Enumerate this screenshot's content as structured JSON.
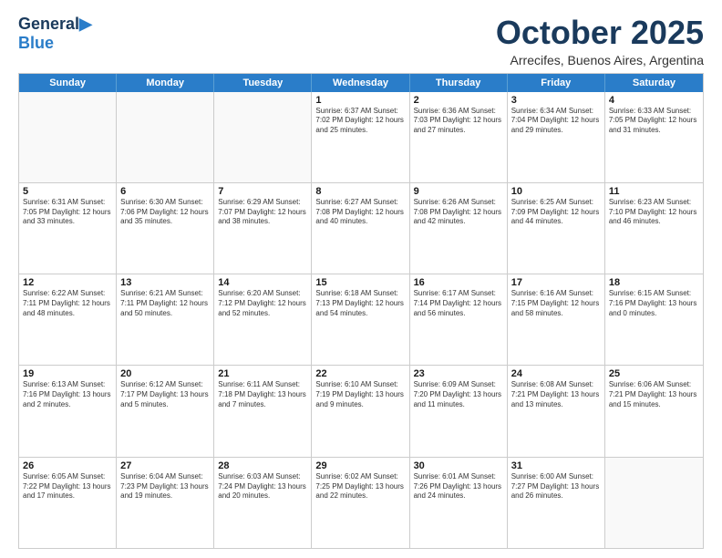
{
  "header": {
    "logo_line1": "General",
    "logo_line2": "Blue",
    "month": "October 2025",
    "location": "Arrecifes, Buenos Aires, Argentina"
  },
  "weekdays": [
    "Sunday",
    "Monday",
    "Tuesday",
    "Wednesday",
    "Thursday",
    "Friday",
    "Saturday"
  ],
  "rows": [
    [
      {
        "day": "",
        "text": ""
      },
      {
        "day": "",
        "text": ""
      },
      {
        "day": "",
        "text": ""
      },
      {
        "day": "1",
        "text": "Sunrise: 6:37 AM\nSunset: 7:02 PM\nDaylight: 12 hours\nand 25 minutes."
      },
      {
        "day": "2",
        "text": "Sunrise: 6:36 AM\nSunset: 7:03 PM\nDaylight: 12 hours\nand 27 minutes."
      },
      {
        "day": "3",
        "text": "Sunrise: 6:34 AM\nSunset: 7:04 PM\nDaylight: 12 hours\nand 29 minutes."
      },
      {
        "day": "4",
        "text": "Sunrise: 6:33 AM\nSunset: 7:05 PM\nDaylight: 12 hours\nand 31 minutes."
      }
    ],
    [
      {
        "day": "5",
        "text": "Sunrise: 6:31 AM\nSunset: 7:05 PM\nDaylight: 12 hours\nand 33 minutes."
      },
      {
        "day": "6",
        "text": "Sunrise: 6:30 AM\nSunset: 7:06 PM\nDaylight: 12 hours\nand 35 minutes."
      },
      {
        "day": "7",
        "text": "Sunrise: 6:29 AM\nSunset: 7:07 PM\nDaylight: 12 hours\nand 38 minutes."
      },
      {
        "day": "8",
        "text": "Sunrise: 6:27 AM\nSunset: 7:08 PM\nDaylight: 12 hours\nand 40 minutes."
      },
      {
        "day": "9",
        "text": "Sunrise: 6:26 AM\nSunset: 7:08 PM\nDaylight: 12 hours\nand 42 minutes."
      },
      {
        "day": "10",
        "text": "Sunrise: 6:25 AM\nSunset: 7:09 PM\nDaylight: 12 hours\nand 44 minutes."
      },
      {
        "day": "11",
        "text": "Sunrise: 6:23 AM\nSunset: 7:10 PM\nDaylight: 12 hours\nand 46 minutes."
      }
    ],
    [
      {
        "day": "12",
        "text": "Sunrise: 6:22 AM\nSunset: 7:11 PM\nDaylight: 12 hours\nand 48 minutes."
      },
      {
        "day": "13",
        "text": "Sunrise: 6:21 AM\nSunset: 7:11 PM\nDaylight: 12 hours\nand 50 minutes."
      },
      {
        "day": "14",
        "text": "Sunrise: 6:20 AM\nSunset: 7:12 PM\nDaylight: 12 hours\nand 52 minutes."
      },
      {
        "day": "15",
        "text": "Sunrise: 6:18 AM\nSunset: 7:13 PM\nDaylight: 12 hours\nand 54 minutes."
      },
      {
        "day": "16",
        "text": "Sunrise: 6:17 AM\nSunset: 7:14 PM\nDaylight: 12 hours\nand 56 minutes."
      },
      {
        "day": "17",
        "text": "Sunrise: 6:16 AM\nSunset: 7:15 PM\nDaylight: 12 hours\nand 58 minutes."
      },
      {
        "day": "18",
        "text": "Sunrise: 6:15 AM\nSunset: 7:16 PM\nDaylight: 13 hours\nand 0 minutes."
      }
    ],
    [
      {
        "day": "19",
        "text": "Sunrise: 6:13 AM\nSunset: 7:16 PM\nDaylight: 13 hours\nand 2 minutes."
      },
      {
        "day": "20",
        "text": "Sunrise: 6:12 AM\nSunset: 7:17 PM\nDaylight: 13 hours\nand 5 minutes."
      },
      {
        "day": "21",
        "text": "Sunrise: 6:11 AM\nSunset: 7:18 PM\nDaylight: 13 hours\nand 7 minutes."
      },
      {
        "day": "22",
        "text": "Sunrise: 6:10 AM\nSunset: 7:19 PM\nDaylight: 13 hours\nand 9 minutes."
      },
      {
        "day": "23",
        "text": "Sunrise: 6:09 AM\nSunset: 7:20 PM\nDaylight: 13 hours\nand 11 minutes."
      },
      {
        "day": "24",
        "text": "Sunrise: 6:08 AM\nSunset: 7:21 PM\nDaylight: 13 hours\nand 13 minutes."
      },
      {
        "day": "25",
        "text": "Sunrise: 6:06 AM\nSunset: 7:21 PM\nDaylight: 13 hours\nand 15 minutes."
      }
    ],
    [
      {
        "day": "26",
        "text": "Sunrise: 6:05 AM\nSunset: 7:22 PM\nDaylight: 13 hours\nand 17 minutes."
      },
      {
        "day": "27",
        "text": "Sunrise: 6:04 AM\nSunset: 7:23 PM\nDaylight: 13 hours\nand 19 minutes."
      },
      {
        "day": "28",
        "text": "Sunrise: 6:03 AM\nSunset: 7:24 PM\nDaylight: 13 hours\nand 20 minutes."
      },
      {
        "day": "29",
        "text": "Sunrise: 6:02 AM\nSunset: 7:25 PM\nDaylight: 13 hours\nand 22 minutes."
      },
      {
        "day": "30",
        "text": "Sunrise: 6:01 AM\nSunset: 7:26 PM\nDaylight: 13 hours\nand 24 minutes."
      },
      {
        "day": "31",
        "text": "Sunrise: 6:00 AM\nSunset: 7:27 PM\nDaylight: 13 hours\nand 26 minutes."
      },
      {
        "day": "",
        "text": ""
      }
    ]
  ]
}
